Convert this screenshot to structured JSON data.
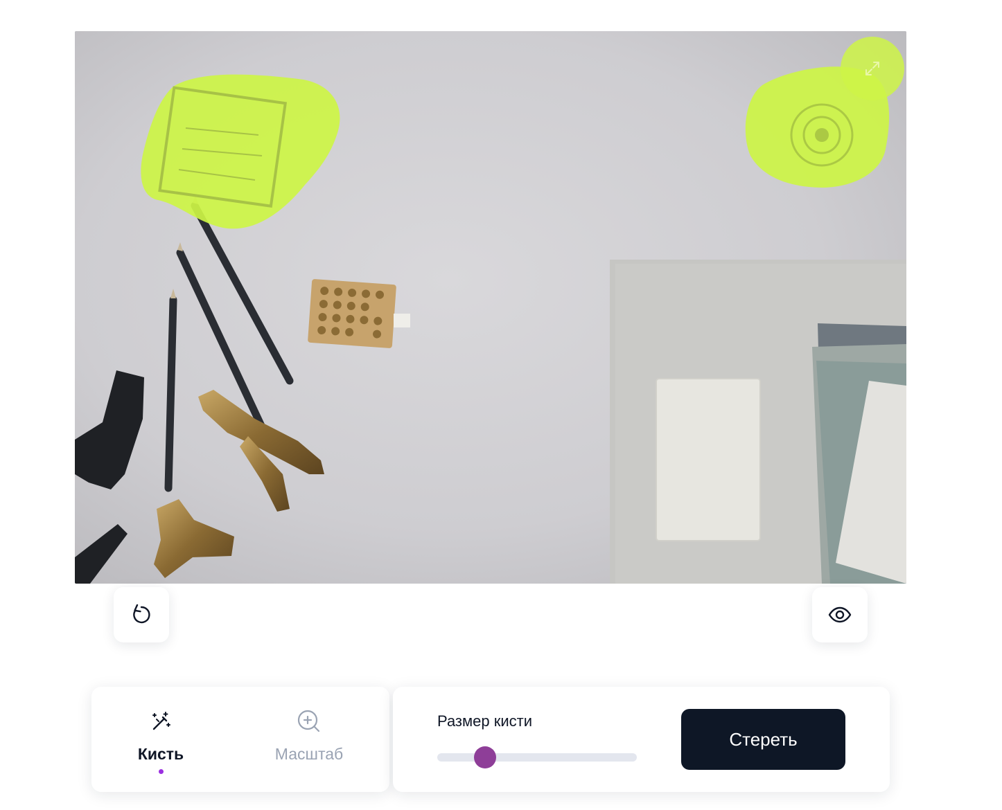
{
  "canvas": {
    "alt": "Рабочий стол с канцелярскими принадлежностями",
    "mask_color": "#cdf545"
  },
  "actions": {
    "undo_icon": "rotate-ccw-icon",
    "preview_icon": "eye-icon",
    "expand_icon": "expand-arrows-icon"
  },
  "tools": [
    {
      "label": "Кисть",
      "icon": "magic-wand-icon",
      "active": true
    },
    {
      "label": "Масштаб",
      "icon": "zoom-in-icon",
      "active": false
    }
  ],
  "brush": {
    "size_label": "Размер кисти",
    "value_fraction": 0.24
  },
  "erase_button": {
    "label": "Стереть"
  },
  "colors": {
    "accent": "#9b2fe0",
    "thumb": "#8e3e98",
    "button_dark": "#0e1726",
    "inactive_text": "#9aa3b3"
  }
}
